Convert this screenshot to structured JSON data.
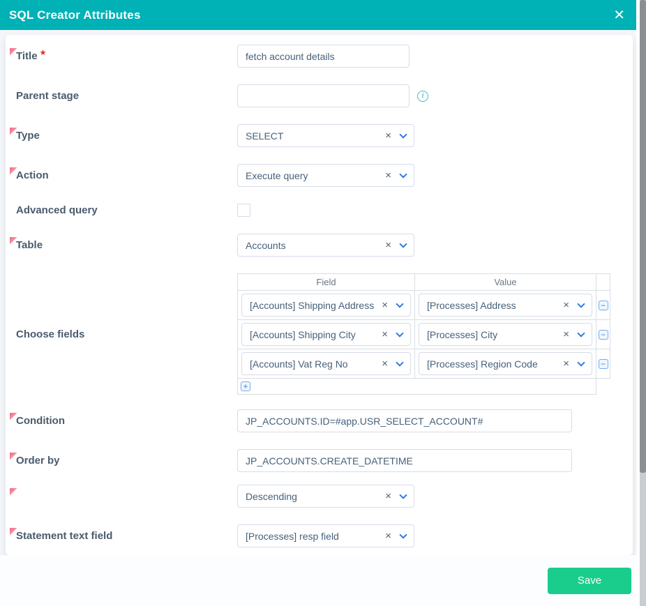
{
  "header": {
    "title": "SQL Creator Attributes"
  },
  "icons": {
    "close": "✕",
    "clear": "×",
    "minus": "−",
    "plus": "+",
    "info": "i",
    "required_star": "★"
  },
  "fields": {
    "title": {
      "label": "Title",
      "required": true,
      "value": "fetch account details"
    },
    "parent_stage": {
      "label": "Parent stage",
      "required": false,
      "value": ""
    },
    "type": {
      "label": "Type",
      "required": true,
      "value": "SELECT"
    },
    "action": {
      "label": "Action",
      "required": true,
      "value": "Execute query"
    },
    "advanced_query": {
      "label": "Advanced query",
      "required": false,
      "checked": false
    },
    "table": {
      "label": "Table",
      "required": true,
      "value": "Accounts"
    },
    "choose_fields": {
      "label": "Choose fields",
      "required": false,
      "columns": [
        "Field",
        "Value"
      ],
      "rows": [
        {
          "field": "[Accounts] Shipping Address",
          "value": "[Processes] Address"
        },
        {
          "field": "[Accounts] Shipping City",
          "value": "[Processes] City"
        },
        {
          "field": "[Accounts] Vat Reg No",
          "value": "[Processes] Region Code"
        }
      ]
    },
    "condition": {
      "label": "Condition",
      "required": true,
      "value": "JP_ACCOUNTS.ID=#app.USR_SELECT_ACCOUNT#"
    },
    "order_by": {
      "label": "Order by",
      "required": true,
      "value": "JP_ACCOUNTS.CREATE_DATETIME"
    },
    "order_direction": {
      "label": "",
      "required": true,
      "value": "Descending"
    },
    "statement_text_field": {
      "label": "Statement text field",
      "required": true,
      "value": "[Processes] resp field"
    }
  },
  "footer": {
    "save_label": "Save"
  },
  "colors": {
    "header_teal": "#00b1b5",
    "save_green": "#1acd8d",
    "accent_blue": "#2e7ce0",
    "flag_pink": "#f3647e",
    "required_red": "#dd2c1e"
  }
}
